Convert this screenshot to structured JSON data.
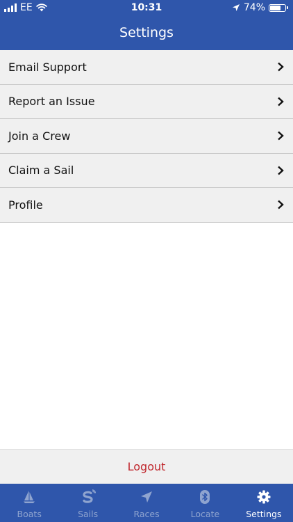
{
  "status_bar": {
    "carrier": "EE",
    "time": "10:31",
    "battery_percent": "74%",
    "battery_level": 0.74,
    "signal_icon": "signal-bars-icon",
    "wifi_icon": "wifi-icon",
    "location_icon": "location-arrow-icon"
  },
  "header": {
    "title": "Settings"
  },
  "menu": {
    "items": [
      {
        "label": "Email Support"
      },
      {
        "label": "Report an Issue"
      },
      {
        "label": "Join a Crew"
      },
      {
        "label": "Claim a Sail"
      },
      {
        "label": "Profile"
      }
    ]
  },
  "logout": {
    "label": "Logout"
  },
  "tabbar": {
    "items": [
      {
        "label": "Boats",
        "icon": "sailboat-icon"
      },
      {
        "label": "Sails",
        "icon": "sails-logo-icon"
      },
      {
        "label": "Races",
        "icon": "navigation-arrow-icon"
      },
      {
        "label": "Locate",
        "icon": "bluetooth-icon"
      },
      {
        "label": "Settings",
        "icon": "gear-icon",
        "active": true
      }
    ]
  },
  "colors": {
    "brand": "#2f56ab",
    "row_bg": "#f0f0f0",
    "logout": "#c0272d",
    "tab_inactive": "#8fa4cf"
  }
}
